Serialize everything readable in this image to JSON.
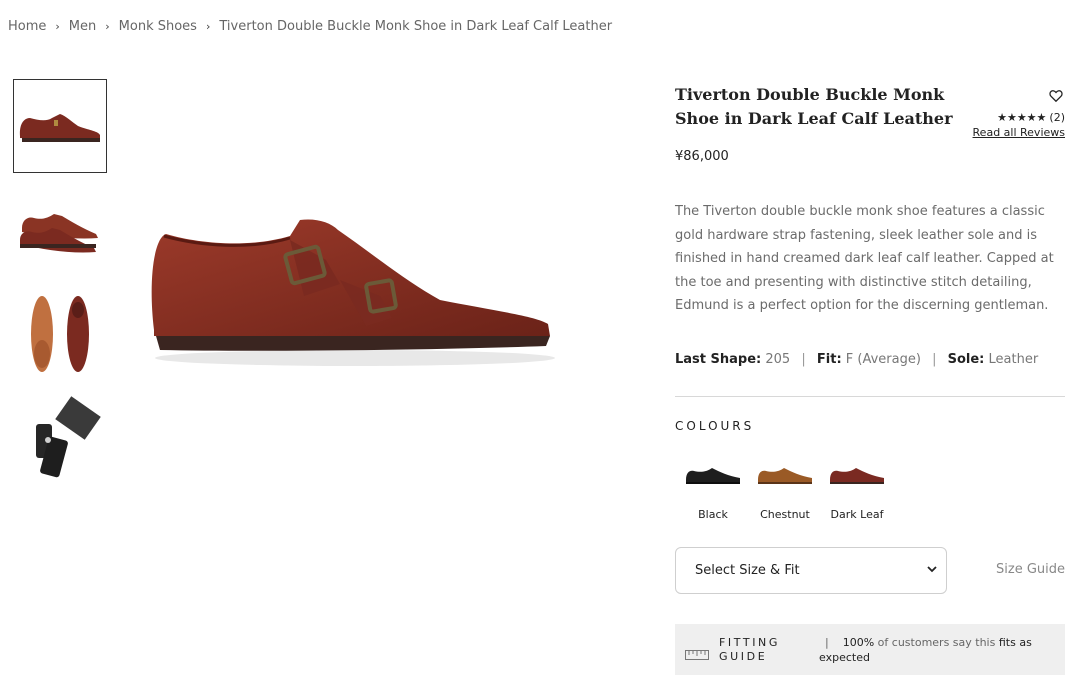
{
  "breadcrumb": {
    "items": [
      "Home",
      "Men",
      "Monk Shoes",
      "Tiverton Double Buckle Monk Shoe in Dark Leaf Calf Leather"
    ],
    "separator": "›"
  },
  "product": {
    "title": "Tiverton Double Buckle Monk Shoe in Dark Leaf Calf Leather",
    "price": "¥86,000",
    "rating_stars": "★★★★★",
    "review_count": "(2)",
    "read_reviews": "Read all Reviews",
    "description": "The Tiverton double buckle monk shoe features a classic gold hardware strap fastening, sleek leather sole and is finished in hand creamed dark leaf calf leather. Capped at the toe and presenting with distinctive stitch detailing, Edmund is a perfect option for the discerning gentleman.",
    "specs": {
      "last_label": "Last Shape:",
      "last_value": "205",
      "fit_label": "Fit:",
      "fit_value": "F (Average)",
      "sole_label": "Sole:",
      "sole_value": "Leather",
      "separator": "|"
    }
  },
  "colours": {
    "heading": "COLOURS",
    "options": [
      {
        "label": "Black",
        "color": "#1e1e1e"
      },
      {
        "label": "Chestnut",
        "color": "#9a5a26"
      },
      {
        "label": "Dark Leaf",
        "color": "#7a2a22"
      }
    ]
  },
  "size": {
    "select_label": "Select Size & Fit",
    "size_guide": "Size Guide"
  },
  "fitting": {
    "label_line1": "FITTING",
    "label_line2": "GUIDE",
    "separator": "|",
    "percent": "100%",
    "text_mid": "of customers say this",
    "fits": "fits as",
    "expected": "expected"
  },
  "colors": {
    "shoe": "#7b2a20",
    "shoe_highlight": "#9c3a2a",
    "sole": "#3a2520"
  },
  "icons": {
    "wishlist": "heart-icon",
    "dropdown": "chevron-down-icon",
    "fitting": "ruler-icon"
  }
}
